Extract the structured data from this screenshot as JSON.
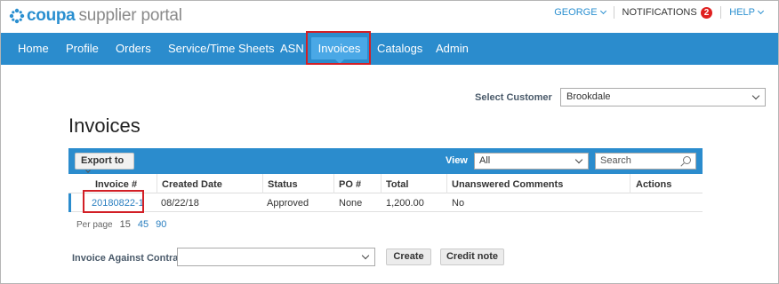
{
  "header": {
    "logo_brand": "coupa",
    "logo_product": "supplier portal",
    "user_menu": "GEORGE",
    "notifications_label": "NOTIFICATIONS",
    "notifications_count": "2",
    "help_menu": "HELP"
  },
  "nav": {
    "items": [
      "Home",
      "Profile",
      "Orders",
      "Service/Time Sheets",
      "ASN",
      "Invoices",
      "Catalogs",
      "Admin"
    ],
    "active": "Invoices"
  },
  "select_customer": {
    "label": "Select Customer",
    "value": "Brookdale"
  },
  "page": {
    "title": "Invoices"
  },
  "toolbar": {
    "export_label": "Export to",
    "view_label": "View",
    "view_value": "All",
    "search_placeholder": "Search"
  },
  "table": {
    "columns": [
      "Invoice #",
      "Created Date",
      "Status",
      "PO #",
      "Total",
      "Unanswered Comments",
      "Actions"
    ],
    "rows": [
      {
        "invoice": "20180822-1",
        "created": "08/22/18",
        "status": "Approved",
        "po": "None",
        "total": "1,200.00",
        "comments": "No",
        "actions": ""
      }
    ]
  },
  "pagination": {
    "label": "Per page",
    "options": [
      "15",
      "45",
      "90"
    ],
    "current": "15"
  },
  "contract": {
    "label": "Invoice Against Contract",
    "value": "",
    "create_label": "Create",
    "credit_note_label": "Credit note"
  },
  "colors": {
    "nav_bg": "#2b8ccd",
    "nav_active": "#4aa8e6",
    "highlight_box": "#d21f26",
    "link": "#2a7fc0"
  }
}
